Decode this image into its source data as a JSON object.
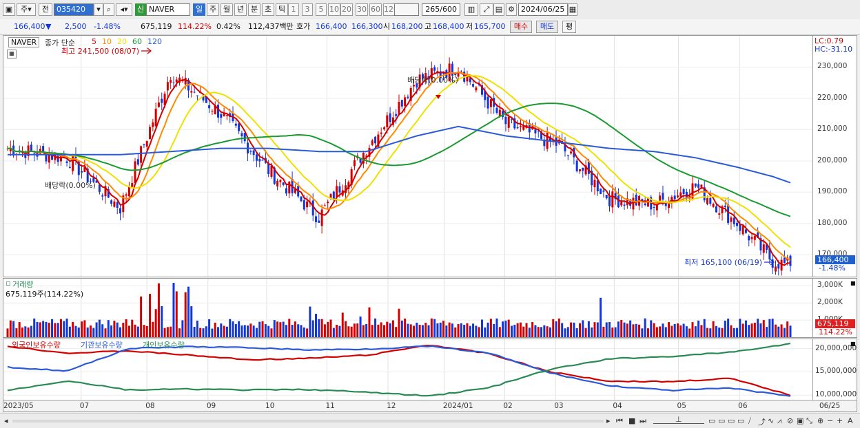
{
  "toolbar": {
    "market": "주",
    "prev": "전",
    "code": "035420",
    "name": "NAVER",
    "badge": "신",
    "periods": [
      "일",
      "주",
      "월",
      "년",
      "분",
      "초",
      "틱"
    ],
    "intervals": [
      "1",
      "3",
      "5",
      "10",
      "20",
      "30",
      "60",
      "120"
    ],
    "count": "265",
    "total": "/600",
    "date": "2024/06/25"
  },
  "quote": {
    "price": "166,400",
    "arrow": "▼",
    "change": "2,500",
    "change_pct": "-1.48%",
    "volume": "675,119",
    "volume_ratio": "114.22%",
    "turnover": "0.42%",
    "amount": "112,437백만",
    "hoga_label": "호가",
    "hoga_ask": "166,400",
    "hoga_bid": "166,300",
    "open_label": "시",
    "open": "168,200",
    "high_label": "고",
    "high": "168,400",
    "low_label": "저",
    "low": "165,700",
    "buy": "매수",
    "sell": "매도",
    "eval": "평"
  },
  "price_panel": {
    "name": "NAVER",
    "legend_prefix": "종가 단순",
    "ma": [
      "5",
      "10",
      "20",
      "60",
      "120"
    ],
    "ma_colors": [
      "#d40000",
      "#ff8a00",
      "#f0e000",
      "#1a9a30",
      "#2a5ad8"
    ],
    "high_marker": "최고 241,500 (08/07)",
    "low_marker": "최저 165,100 (06/19)",
    "ex_div_1": "배당락(0.00%)",
    "ex_div_2": "배당락(0.00%)",
    "lc": "LC:0.79",
    "hc": "HC:-31.10",
    "current_label": "166,400",
    "current_pct": "-1.48%"
  },
  "volume_panel": {
    "title": "거래량",
    "value": "675,119주(114.22%)",
    "current_label": "675,119",
    "current_pct": "114.22%"
  },
  "holdings_panel": {
    "series": [
      "외국인보유수량",
      "기관보유수량",
      "개인보유수량"
    ],
    "colors": [
      "#d40000",
      "#2a5ad8",
      "#2a8a55"
    ]
  },
  "x_labels": [
    "2023/05",
    "07",
    "08",
    "09",
    "10",
    "11",
    "12",
    "2024/01",
    "02",
    "03",
    "04",
    "05",
    "06",
    "06/25"
  ],
  "chart_data": [
    {
      "type": "line",
      "title": "NAVER",
      "y_ticks": [
        "230,000",
        "220,000",
        "210,000",
        "200,000",
        "190,000",
        "180,000",
        "170,000"
      ],
      "ylim": [
        163000,
        240000
      ],
      "x": [
        "2023/05",
        "07",
        "08",
        "09",
        "10",
        "11",
        "12",
        "2024/01",
        "02",
        "03",
        "04",
        "05",
        "06",
        "06/25"
      ],
      "series": [
        {
          "name": "5",
          "close": [
            204000,
            201000,
            185000,
            228000,
            215000,
            197000,
            182000,
            204000,
            226000,
            230000,
            212000,
            205000,
            188000,
            186000,
            192000,
            180000,
            168000,
            166400
          ]
        },
        {
          "name": "120",
          "values": [
            202000,
            202000,
            202000,
            203000,
            204000,
            204000,
            203000,
            203000,
            208000,
            211000,
            208000,
            206000,
            204000,
            203000,
            201000,
            198000,
            195000,
            193000
          ]
        }
      ]
    },
    {
      "type": "bar",
      "title": "거래량",
      "y_ticks": [
        "3,000K",
        "2,000K",
        "1,000K"
      ],
      "ylim": [
        0,
        3300000
      ]
    },
    {
      "type": "line",
      "series": [
        {
          "name": "외국인보유수량",
          "values": [
            20500000,
            19000000,
            19500000,
            18600000,
            17600000,
            17900000,
            18600000,
            20800000,
            18900000,
            15000000,
            13000000,
            12900000,
            13600000,
            10000000
          ]
        },
        {
          "name": "기관보유수량",
          "values": [
            16000000,
            15200000,
            20000000,
            20400000,
            20200000,
            19700000,
            19900000,
            20500000,
            19000000,
            14800000,
            12000000,
            11000000,
            11500000,
            9800000
          ]
        },
        {
          "name": "개인보유수량",
          "values": [
            11000000,
            13100000,
            11100000,
            11300000,
            11100000,
            11200000,
            10600000,
            9800000,
            11600000,
            15500000,
            17800000,
            18300000,
            19200000,
            21000000
          ]
        }
      ],
      "y_ticks": [
        "20,000,000",
        "15,000,000",
        "10,000,000"
      ],
      "ylim": [
        9000000,
        22000000
      ]
    }
  ]
}
